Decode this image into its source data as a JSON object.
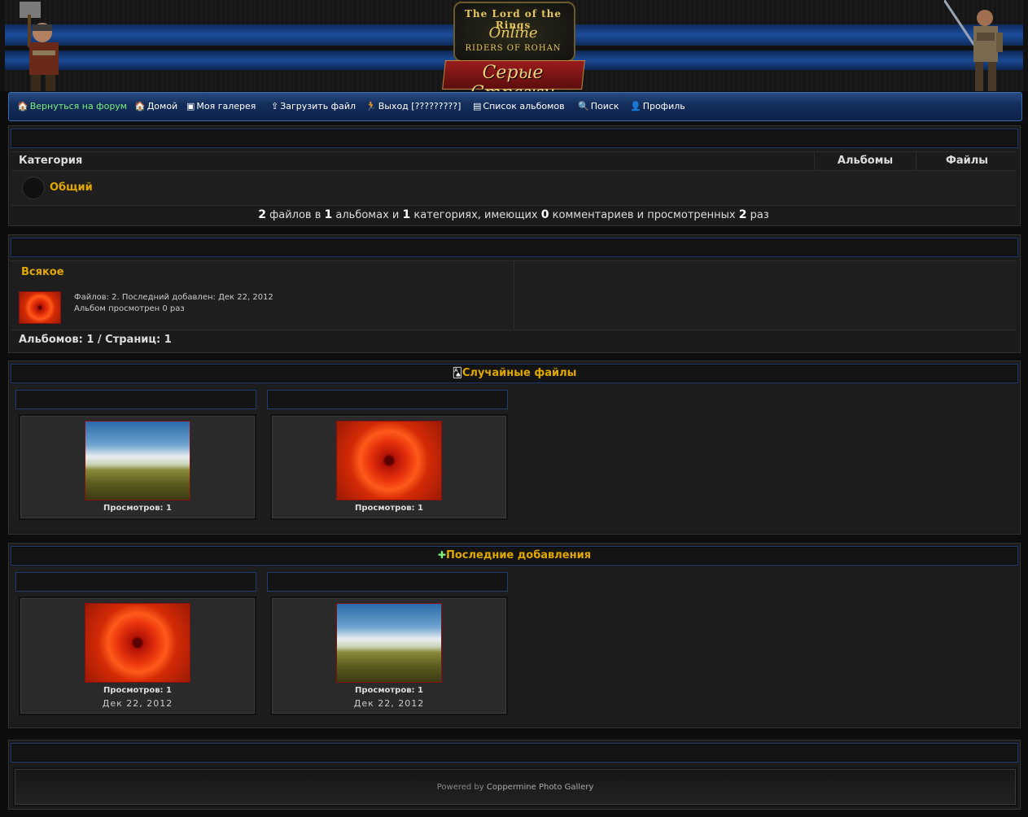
{
  "header": {
    "logo_line1": "The Lord of the Rings",
    "logo_line2": "Online",
    "logo_line3": "RIDERS OF ROHAN",
    "logo_ru": "Серые Стражи"
  },
  "nav": {
    "items": [
      {
        "label": "Вернуться на форум",
        "icon": "home-icon"
      },
      {
        "label": "Домой",
        "icon": "home-icon"
      },
      {
        "label": "Моя галерея",
        "icon": "gallery-icon"
      },
      {
        "label": "Загрузить файл",
        "icon": "upload-icon"
      },
      {
        "label": "Выход [?????????]",
        "icon": "logout-icon"
      },
      {
        "label": "Список альбомов",
        "icon": "albums-icon"
      },
      {
        "label": "Поиск",
        "icon": "search-icon"
      },
      {
        "label": "Профиль",
        "icon": "profile-icon"
      }
    ]
  },
  "categories": {
    "col_category": "Категория",
    "col_albums": "Альбомы",
    "col_files": "Файлы",
    "row_name": "Общий",
    "stats_files": "2",
    "stats_t1": "файлов в",
    "stats_albums": "1",
    "stats_t2": "альбомах и",
    "stats_cats": "1",
    "stats_t3": "категориях, имеющих",
    "stats_comments": "0",
    "stats_t4": "комментариев и просмотренных",
    "stats_views": "2",
    "stats_t5": "раз"
  },
  "albums": {
    "name": "Всякое",
    "info1": "Файлов: 2. Последний добавлен: Дек 22, 2012",
    "info2": "Альбом просмотрен 0 раз",
    "footer": "Альбомов: 1 / Страниц: 1"
  },
  "random": {
    "title": "Случайные файлы",
    "items": [
      {
        "views": "Просмотров: 1",
        "image": "wheat-field"
      },
      {
        "views": "Просмотров: 1",
        "image": "red-flower"
      }
    ]
  },
  "latest": {
    "title": "Последние добавления",
    "items": [
      {
        "views": "Просмотров: 1",
        "date": "Дек 22, 2012",
        "image": "red-flower"
      },
      {
        "views": "Просмотров: 1",
        "date": "Дек 22, 2012",
        "image": "wheat-field"
      }
    ]
  },
  "footer": {
    "powered_by": "Powered by",
    "link": "Coppermine Photo Gallery"
  }
}
